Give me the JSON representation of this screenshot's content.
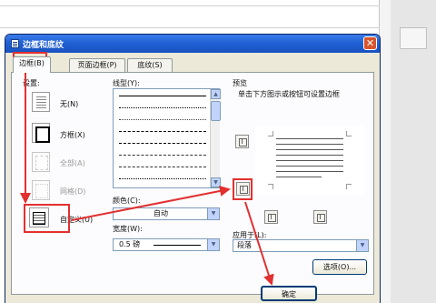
{
  "dialog": {
    "title": "边框和底纹",
    "close_symbol": "✕"
  },
  "tabs": [
    {
      "label": "边框(B)",
      "active": true
    },
    {
      "label": "页面边框(P)",
      "active": false
    },
    {
      "label": "底纹(S)",
      "active": false
    }
  ],
  "settings": {
    "header": "设置:",
    "items": [
      {
        "label": "无(N)",
        "icon": "border-none-icon",
        "enabled": true
      },
      {
        "label": "方框(X)",
        "icon": "border-box-icon",
        "enabled": true
      },
      {
        "label": "全部(A)",
        "icon": "border-all-icon",
        "enabled": false
      },
      {
        "label": "网格(D)",
        "icon": "border-grid-icon",
        "enabled": false
      },
      {
        "label": "自定义(U)",
        "icon": "border-custom-icon",
        "enabled": true
      }
    ]
  },
  "line_style": {
    "header": "线型(Y):"
  },
  "color": {
    "label": "颜色(C):",
    "value": "自动"
  },
  "width": {
    "label": "宽度(W):",
    "value": "0.5 磅"
  },
  "preview": {
    "header": "预览",
    "hint": "单击下方图示或按钮可设置边框"
  },
  "apply_to": {
    "label": "应用于(L):",
    "value": "段落"
  },
  "buttons": {
    "options": "选项(O)...",
    "ok": "确定"
  },
  "colors": {
    "annotation": "#e23030",
    "titlebar": "#1f5fd3",
    "dialog_face": "#ece9d8"
  }
}
